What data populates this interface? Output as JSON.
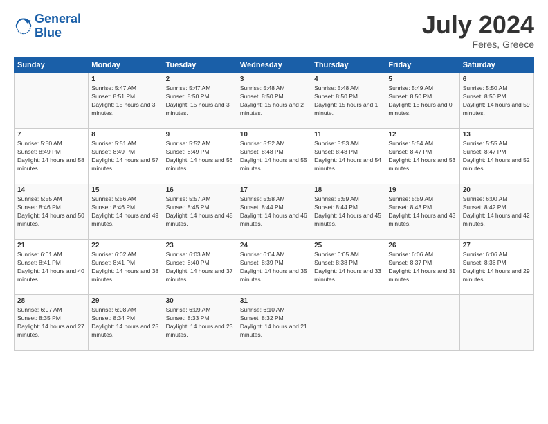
{
  "header": {
    "logo_text_1": "General",
    "logo_text_2": "Blue",
    "month_year": "July 2024",
    "location": "Feres, Greece"
  },
  "weekdays": [
    "Sunday",
    "Monday",
    "Tuesday",
    "Wednesday",
    "Thursday",
    "Friday",
    "Saturday"
  ],
  "weeks": [
    [
      {
        "day": "",
        "sunrise": "",
        "sunset": "",
        "daylight": ""
      },
      {
        "day": "1",
        "sunrise": "5:47 AM",
        "sunset": "8:51 PM",
        "daylight": "15 hours and 3 minutes."
      },
      {
        "day": "2",
        "sunrise": "5:47 AM",
        "sunset": "8:50 PM",
        "daylight": "15 hours and 3 minutes."
      },
      {
        "day": "3",
        "sunrise": "5:48 AM",
        "sunset": "8:50 PM",
        "daylight": "15 hours and 2 minutes."
      },
      {
        "day": "4",
        "sunrise": "5:48 AM",
        "sunset": "8:50 PM",
        "daylight": "15 hours and 1 minute."
      },
      {
        "day": "5",
        "sunrise": "5:49 AM",
        "sunset": "8:50 PM",
        "daylight": "15 hours and 0 minutes."
      },
      {
        "day": "6",
        "sunrise": "5:50 AM",
        "sunset": "8:50 PM",
        "daylight": "14 hours and 59 minutes."
      }
    ],
    [
      {
        "day": "7",
        "sunrise": "5:50 AM",
        "sunset": "8:49 PM",
        "daylight": "14 hours and 58 minutes."
      },
      {
        "day": "8",
        "sunrise": "5:51 AM",
        "sunset": "8:49 PM",
        "daylight": "14 hours and 57 minutes."
      },
      {
        "day": "9",
        "sunrise": "5:52 AM",
        "sunset": "8:49 PM",
        "daylight": "14 hours and 56 minutes."
      },
      {
        "day": "10",
        "sunrise": "5:52 AM",
        "sunset": "8:48 PM",
        "daylight": "14 hours and 55 minutes."
      },
      {
        "day": "11",
        "sunrise": "5:53 AM",
        "sunset": "8:48 PM",
        "daylight": "14 hours and 54 minutes."
      },
      {
        "day": "12",
        "sunrise": "5:54 AM",
        "sunset": "8:47 PM",
        "daylight": "14 hours and 53 minutes."
      },
      {
        "day": "13",
        "sunrise": "5:55 AM",
        "sunset": "8:47 PM",
        "daylight": "14 hours and 52 minutes."
      }
    ],
    [
      {
        "day": "14",
        "sunrise": "5:55 AM",
        "sunset": "8:46 PM",
        "daylight": "14 hours and 50 minutes."
      },
      {
        "day": "15",
        "sunrise": "5:56 AM",
        "sunset": "8:46 PM",
        "daylight": "14 hours and 49 minutes."
      },
      {
        "day": "16",
        "sunrise": "5:57 AM",
        "sunset": "8:45 PM",
        "daylight": "14 hours and 48 minutes."
      },
      {
        "day": "17",
        "sunrise": "5:58 AM",
        "sunset": "8:44 PM",
        "daylight": "14 hours and 46 minutes."
      },
      {
        "day": "18",
        "sunrise": "5:59 AM",
        "sunset": "8:44 PM",
        "daylight": "14 hours and 45 minutes."
      },
      {
        "day": "19",
        "sunrise": "5:59 AM",
        "sunset": "8:43 PM",
        "daylight": "14 hours and 43 minutes."
      },
      {
        "day": "20",
        "sunrise": "6:00 AM",
        "sunset": "8:42 PM",
        "daylight": "14 hours and 42 minutes."
      }
    ],
    [
      {
        "day": "21",
        "sunrise": "6:01 AM",
        "sunset": "8:41 PM",
        "daylight": "14 hours and 40 minutes."
      },
      {
        "day": "22",
        "sunrise": "6:02 AM",
        "sunset": "8:41 PM",
        "daylight": "14 hours and 38 minutes."
      },
      {
        "day": "23",
        "sunrise": "6:03 AM",
        "sunset": "8:40 PM",
        "daylight": "14 hours and 37 minutes."
      },
      {
        "day": "24",
        "sunrise": "6:04 AM",
        "sunset": "8:39 PM",
        "daylight": "14 hours and 35 minutes."
      },
      {
        "day": "25",
        "sunrise": "6:05 AM",
        "sunset": "8:38 PM",
        "daylight": "14 hours and 33 minutes."
      },
      {
        "day": "26",
        "sunrise": "6:06 AM",
        "sunset": "8:37 PM",
        "daylight": "14 hours and 31 minutes."
      },
      {
        "day": "27",
        "sunrise": "6:06 AM",
        "sunset": "8:36 PM",
        "daylight": "14 hours and 29 minutes."
      }
    ],
    [
      {
        "day": "28",
        "sunrise": "6:07 AM",
        "sunset": "8:35 PM",
        "daylight": "14 hours and 27 minutes."
      },
      {
        "day": "29",
        "sunrise": "6:08 AM",
        "sunset": "8:34 PM",
        "daylight": "14 hours and 25 minutes."
      },
      {
        "day": "30",
        "sunrise": "6:09 AM",
        "sunset": "8:33 PM",
        "daylight": "14 hours and 23 minutes."
      },
      {
        "day": "31",
        "sunrise": "6:10 AM",
        "sunset": "8:32 PM",
        "daylight": "14 hours and 21 minutes."
      },
      {
        "day": "",
        "sunrise": "",
        "sunset": "",
        "daylight": ""
      },
      {
        "day": "",
        "sunrise": "",
        "sunset": "",
        "daylight": ""
      },
      {
        "day": "",
        "sunrise": "",
        "sunset": "",
        "daylight": ""
      }
    ]
  ]
}
